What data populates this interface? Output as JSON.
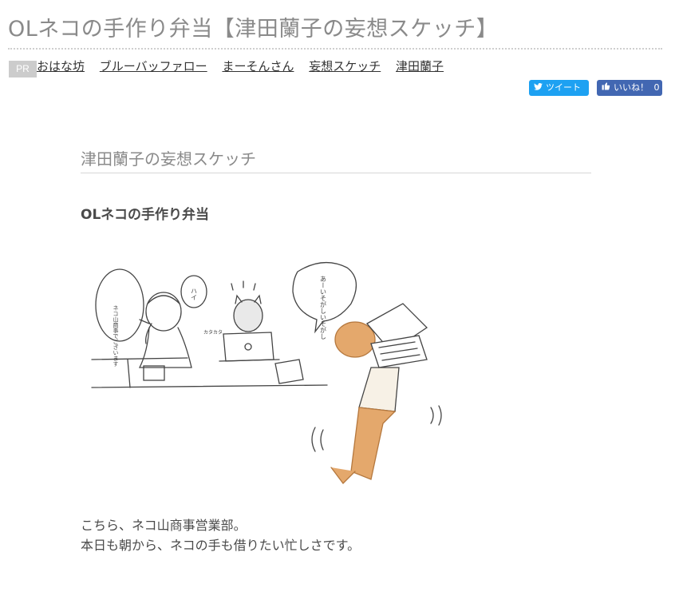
{
  "page": {
    "title": "OLネコの手作り弁当【津田蘭子の妄想スケッチ】"
  },
  "tags": {
    "badge": "PR",
    "items": [
      "おはな坊",
      "ブルーバッファロー",
      "まーそんさん",
      "妄想スケッチ",
      "津田蘭子"
    ]
  },
  "share": {
    "tweet_label": "ツイート",
    "like_label": "いいね！",
    "like_count": "0",
    "tweet_color": "#1da1f2",
    "like_color": "#4267b2"
  },
  "section": {
    "title": "津田蘭子の妄想スケッチ"
  },
  "article": {
    "title": "OLネコの手作り弁当",
    "illustration": {
      "bubble_phone": "ネコ山商事でございます",
      "bubble_reply": "ハイ",
      "bubble_busy": "あーいそがしいそがし",
      "sfx": "カタカタ"
    },
    "body": [
      "こちら、ネコ山商事営業部。",
      "本日も朝から、ネコの手も借りたい忙しさです。"
    ]
  }
}
